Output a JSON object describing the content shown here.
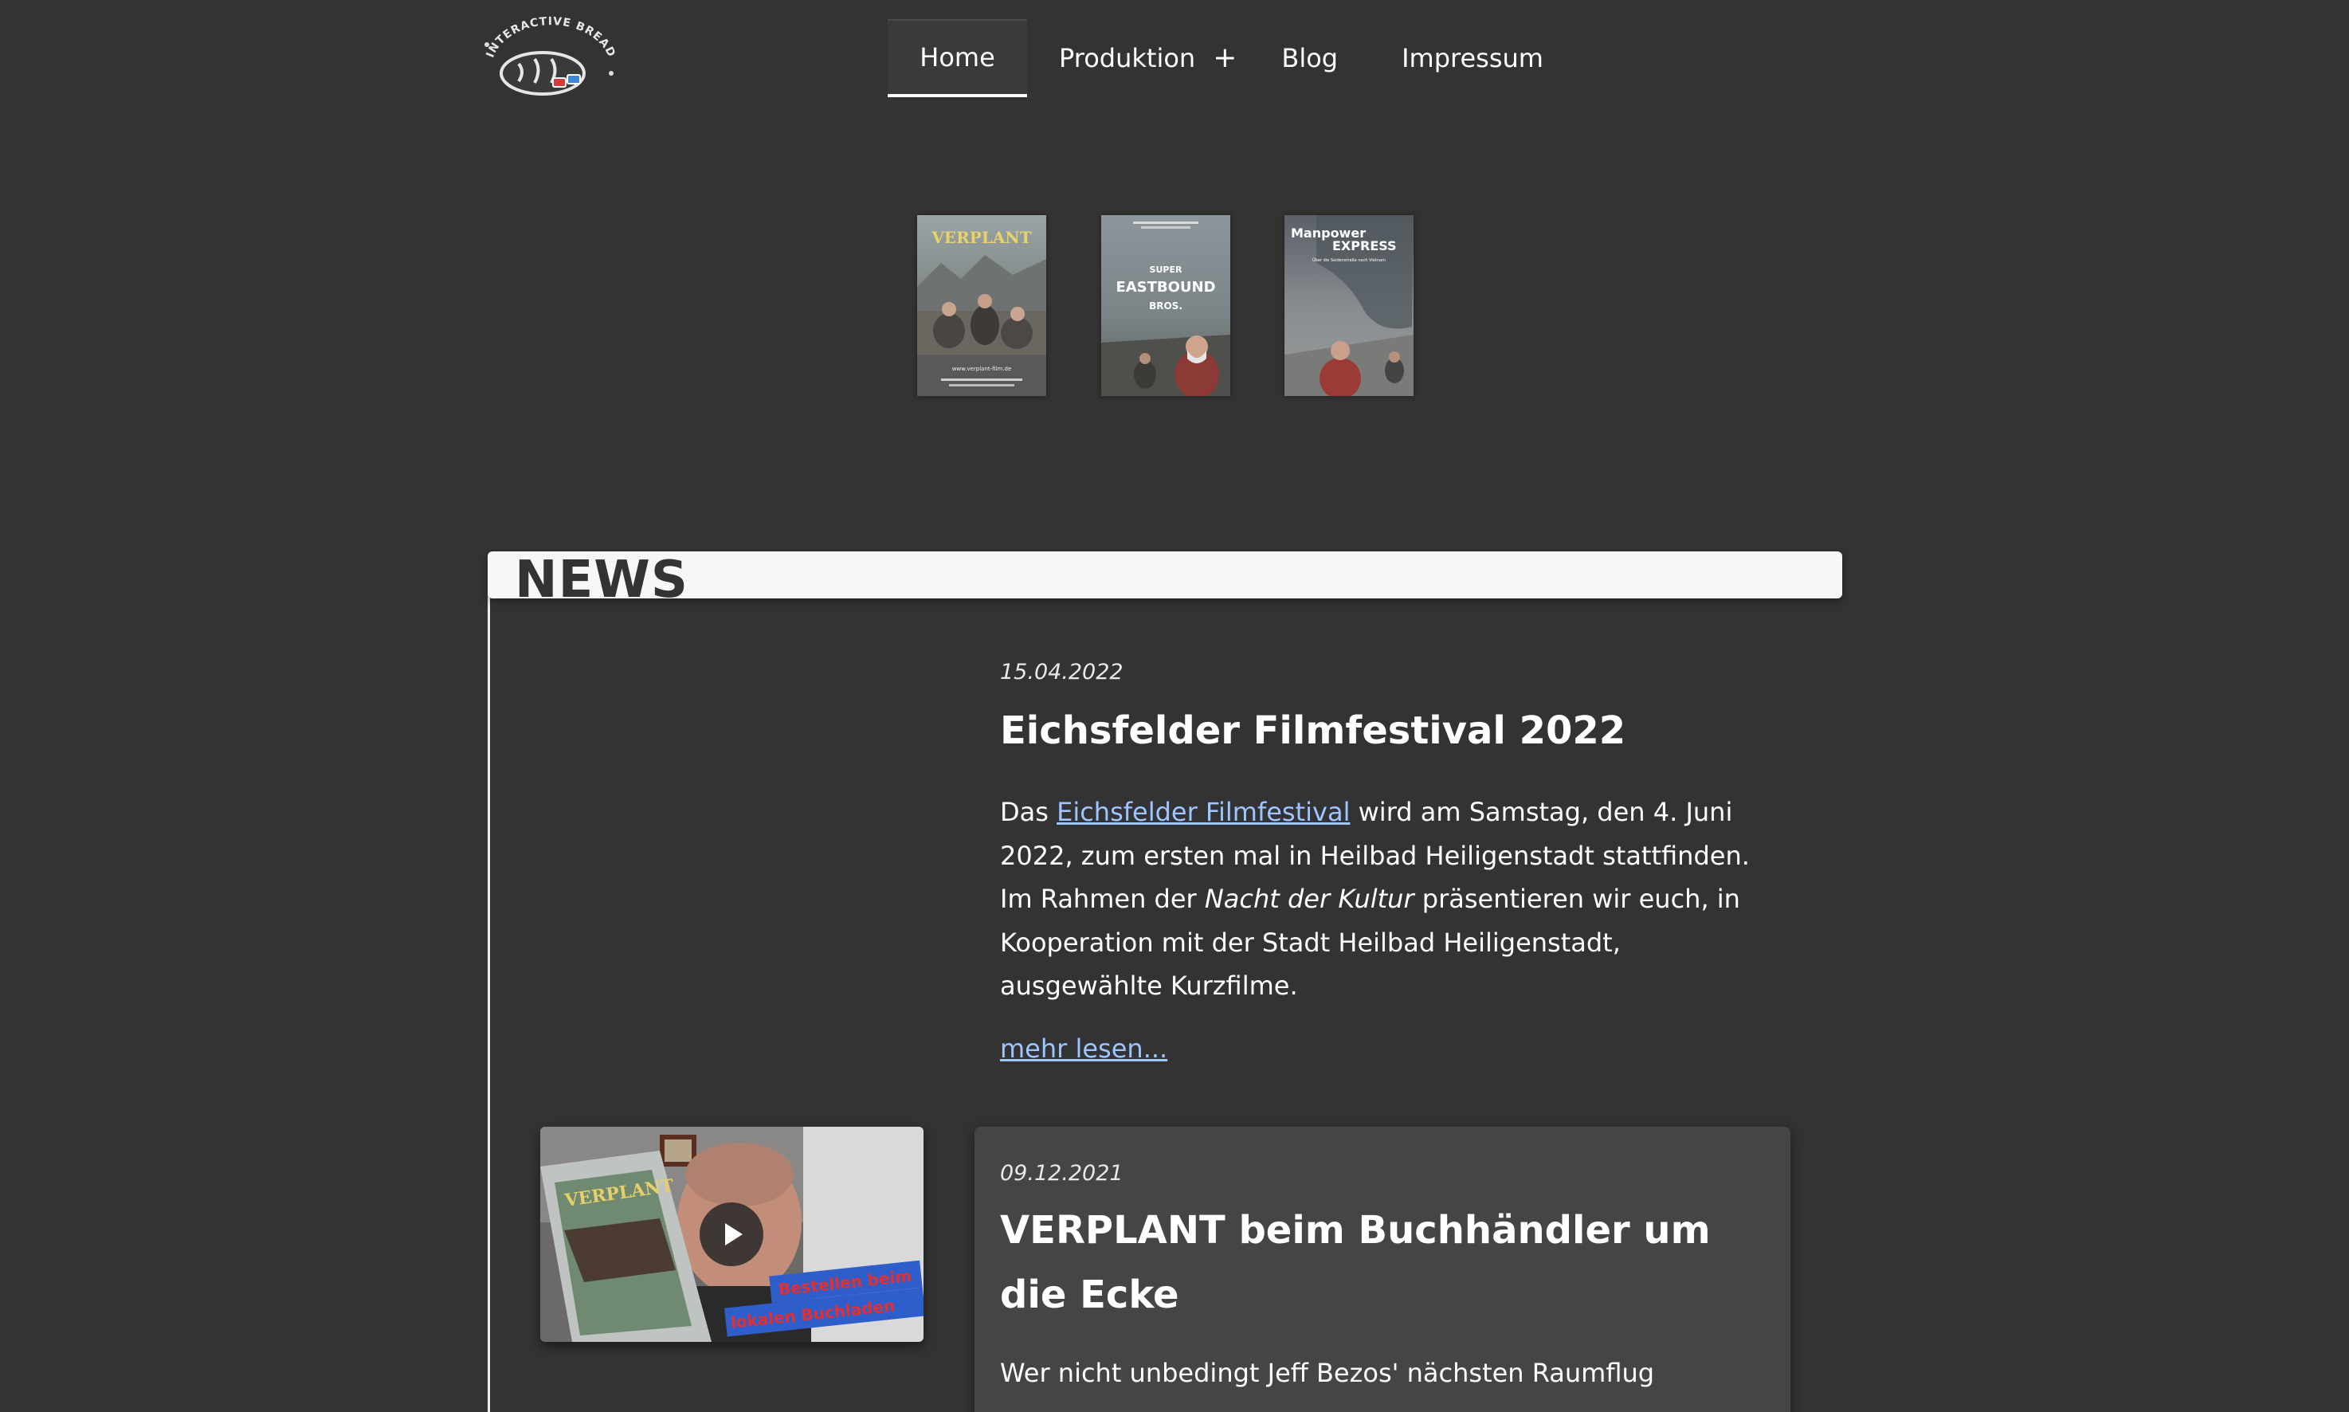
{
  "header": {
    "logo_text": "INTERACTIVE BREAD",
    "nav": [
      {
        "label": "Home",
        "active": true
      },
      {
        "label": "Produktion",
        "has_submenu": true,
        "submenu_icon": "+"
      },
      {
        "label": "Blog"
      },
      {
        "label": "Impressum"
      }
    ]
  },
  "posters": [
    {
      "title": "VERPLANT",
      "caption": "www.verplant-film.de"
    },
    {
      "title_top": "SUPER",
      "title_main": "EASTBOUND",
      "title_bottom": "BROS."
    },
    {
      "title_line1": "Manpower",
      "title_line2": "EXPRESS",
      "subtitle": "Über die Seidenstraße nach Vietnam"
    }
  ],
  "news": {
    "heading": "NEWS",
    "articles": [
      {
        "date": "15.04.2022",
        "title": "Eichsfelder Filmfestival 2022",
        "text_before_link": "Das ",
        "link_text": "Eichsfelder Filmfestival",
        "text_after_link": " wird am Samstag, den 4. Juni 2022, zum ersten mal in Heilbad Heiligenstadt stattfinden. Im Rahmen der ",
        "italic_text": "Nacht der Kultur",
        "text_end": " präsentieren wir euch, in Kooperation mit der Stadt Heilbad Heiligenstadt, ausgewählte Kurzfilme.",
        "more_label": "mehr lesen..."
      },
      {
        "date": "09.12.2021",
        "title": "VERPLANT beim Buchhändler um die Ecke",
        "text": "Wer nicht unbedingt Jeff Bezos' nächsten Raumflug",
        "video": {
          "book_title": "VERPLANT",
          "banner_line1": "Bestellen beim",
          "banner_line2": "lokalen Buchladen"
        }
      }
    ]
  },
  "colors": {
    "background": "#333333",
    "link": "#9ec5ff",
    "card": "#454545",
    "news_bar": "#f7f7f7"
  }
}
